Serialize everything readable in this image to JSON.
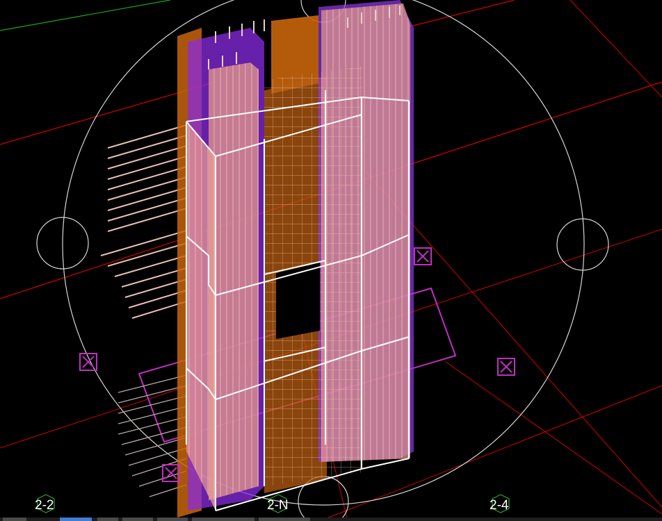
{
  "viewport": {
    "title": "",
    "background": "#000000",
    "colors": {
      "grid_red": "#d60000",
      "grid_green": "#1aa81a",
      "circle": "#d8d8d8",
      "wall_fill": "#e59a8c",
      "wall_edge": "#ffffff",
      "purple": "#a020f0",
      "orange": "#c8650c",
      "magenta": "#c030c0",
      "rebar": "#f0c8b8"
    }
  },
  "grid_markers": [
    {
      "label": "2-2",
      "icon": "hexagon-badge"
    },
    {
      "label": "2-N",
      "icon": "hexagon-badge"
    },
    {
      "label": "2-4",
      "icon": "hexagon-badge"
    }
  ],
  "support_markers": [
    {
      "icon": "boxed-x-icon"
    },
    {
      "icon": "boxed-x-icon"
    },
    {
      "icon": "boxed-x-icon"
    },
    {
      "icon": "boxed-x-icon"
    }
  ],
  "tab_strip": {
    "active_index": 1,
    "tab_count": 8
  }
}
